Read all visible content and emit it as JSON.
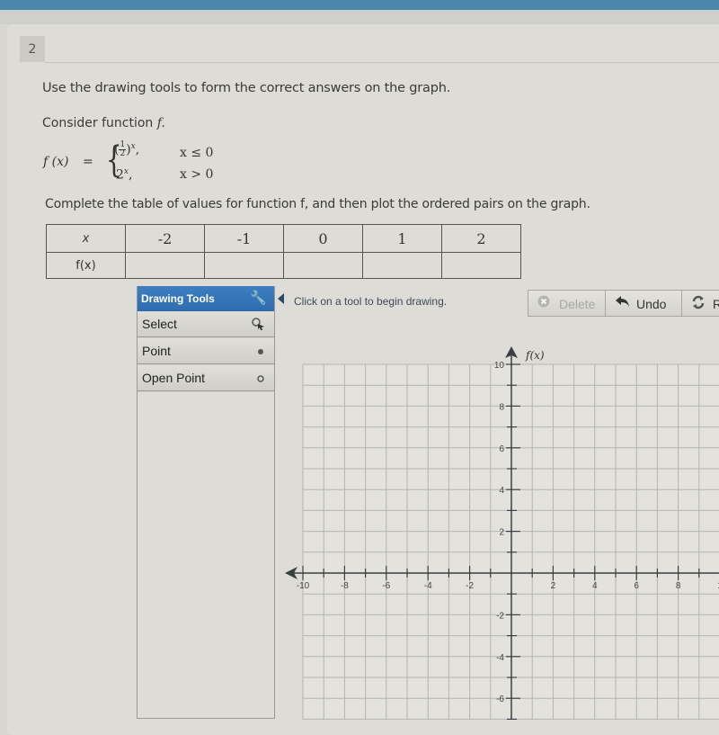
{
  "question": {
    "number": "2",
    "instruction": "Use the drawing tools to form the correct answers on the graph.",
    "consider_prefix": "Consider function ",
    "consider_fn": "f.",
    "function": {
      "name": "f (x)",
      "equals": "=",
      "case1_expr_base_num": "1",
      "case1_expr_base_den": "2",
      "case1_exponent": "x",
      "case1_condition": "x ≤ 0",
      "case2_expr": "2",
      "case2_exponent": "x",
      "case2_condition": "x > 0"
    },
    "complete_text": "Complete the table of values for function f, and then plot the ordered pairs on the graph."
  },
  "table": {
    "row_x_label": "x",
    "row_fx_label": "f(x)",
    "x_values": [
      "-2",
      "-1",
      "0",
      "1",
      "2"
    ],
    "fx_values": [
      "",
      "",
      "",
      "",
      ""
    ]
  },
  "drawing_tools": {
    "header": "Drawing Tools",
    "items": [
      {
        "label": "Select",
        "icon": "select-cursor-icon"
      },
      {
        "label": "Point",
        "icon": "filled-dot-icon"
      },
      {
        "label": "Open Point",
        "icon": "open-dot-icon"
      }
    ],
    "status_text": "Click on a tool to begin drawing."
  },
  "toolbar": {
    "delete_label": "Delete",
    "undo_label": "Undo",
    "reset_label": "R"
  },
  "graph": {
    "y_axis_label": "f(x)",
    "x_ticks": [
      "-10",
      "-8",
      "-6",
      "-4",
      "-2",
      "2",
      "4",
      "6",
      "8",
      "1"
    ],
    "y_ticks": [
      "10",
      "8",
      "6",
      "4",
      "2",
      "-2",
      "-4",
      "-6"
    ]
  },
  "colors": {
    "accent": "#3d7fc1",
    "topbar": "#4a86ab",
    "axis": "#3a3f45",
    "grid": "#b5b4b0"
  }
}
